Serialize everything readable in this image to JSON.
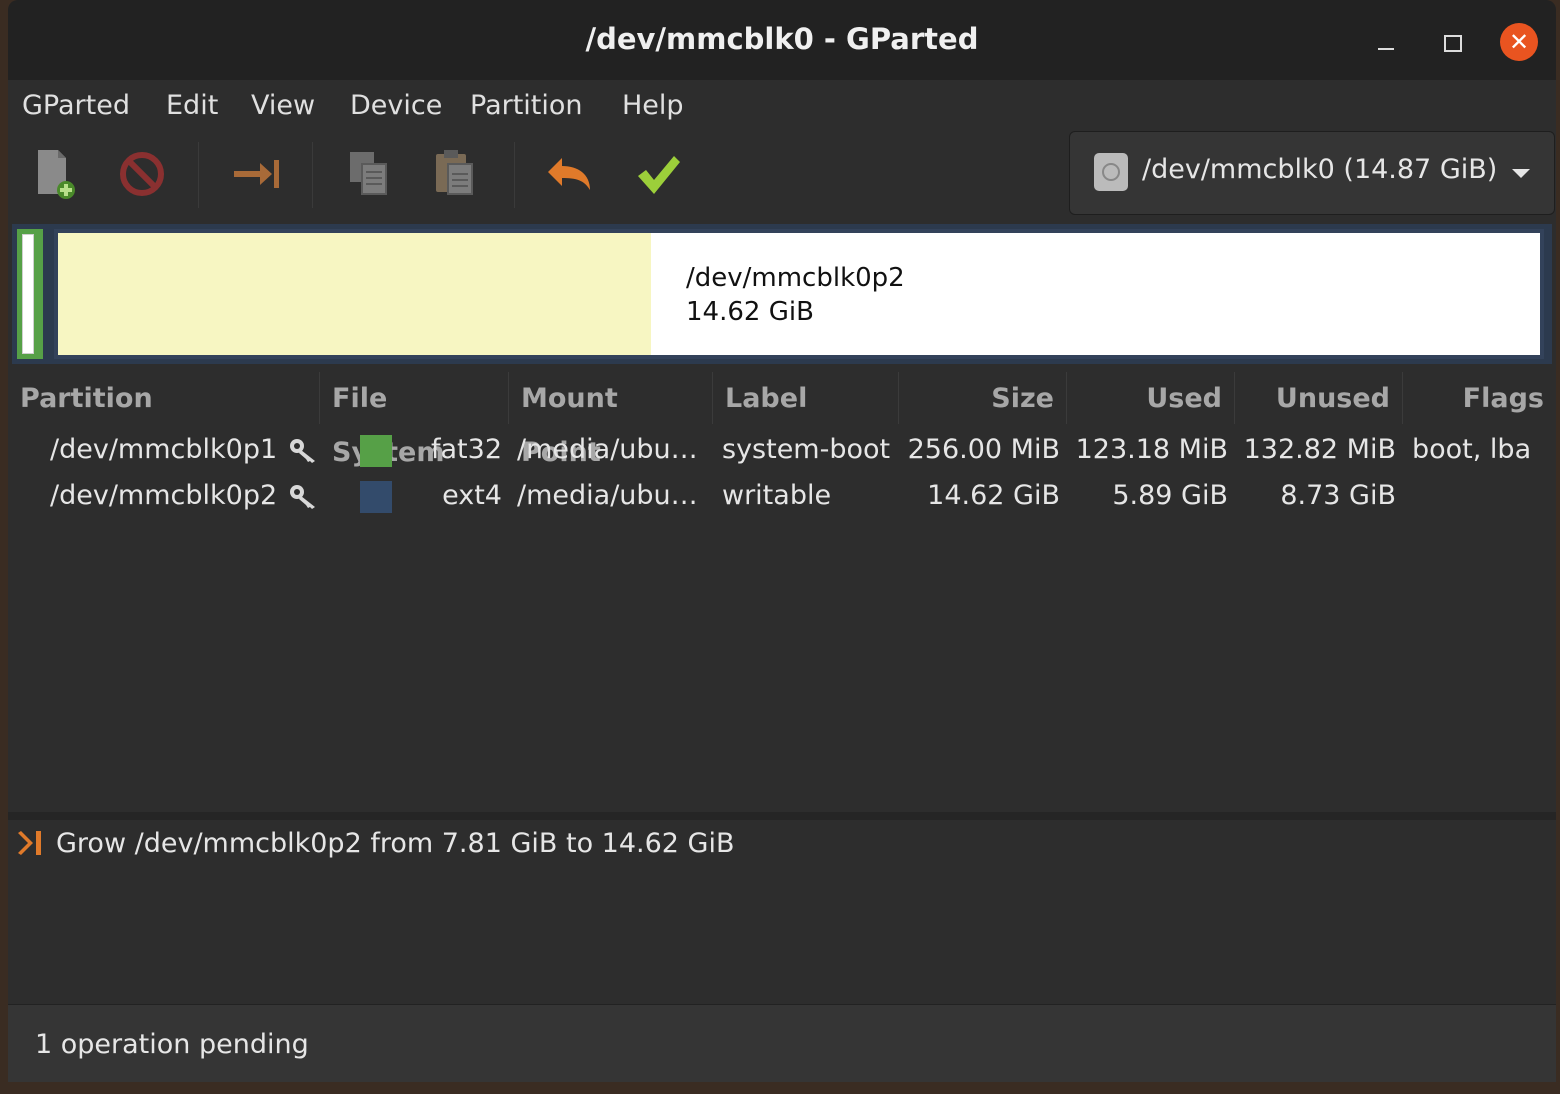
{
  "window": {
    "title": "/dev/mmcblk0 - GParted",
    "close_glyph": "✕"
  },
  "menu": [
    "GParted",
    "Edit",
    "View",
    "Device",
    "Partition",
    "Help"
  ],
  "toolbar": {
    "buttons": [
      "new-partition-icon",
      "delete-icon",
      "resize-move-icon",
      "copy-icon",
      "paste-icon",
      "undo-icon",
      "apply-icon"
    ],
    "device_selector": "/dev/mmcblk0 (14.87 GiB)"
  },
  "disk_map": {
    "partition2_name": "/dev/mmcblk0p2",
    "partition2_size": "14.62 GiB",
    "partition2_used_fraction": 0.4
  },
  "table": {
    "headers": [
      "Partition",
      "File System",
      "Mount Point",
      "Label",
      "Size",
      "Used",
      "Unused",
      "Flags"
    ],
    "rows": [
      {
        "partition": "/dev/mmcblk0p1",
        "fs_color": "#56a047",
        "filesystem": "fat32",
        "mount": "/media/ubu…",
        "label": "system-boot",
        "size": "256.00 MiB",
        "used": "123.18 MiB",
        "unused": "132.82 MiB",
        "flags": "boot, lba"
      },
      {
        "partition": "/dev/mmcblk0p2",
        "fs_color": "#334b6b",
        "filesystem": "ext4",
        "mount": "/media/ubu…",
        "label": "writable",
        "size": "14.62 GiB",
        "used": "5.89 GiB",
        "unused": "8.73 GiB",
        "flags": ""
      }
    ]
  },
  "operations": [
    "Grow /dev/mmcblk0p2 from 7.81 GiB to 14.62 GiB"
  ],
  "status": "1 operation pending",
  "colors": {
    "accent_close": "#e95420",
    "fat32": "#56a047",
    "ext4": "#334b6b"
  }
}
